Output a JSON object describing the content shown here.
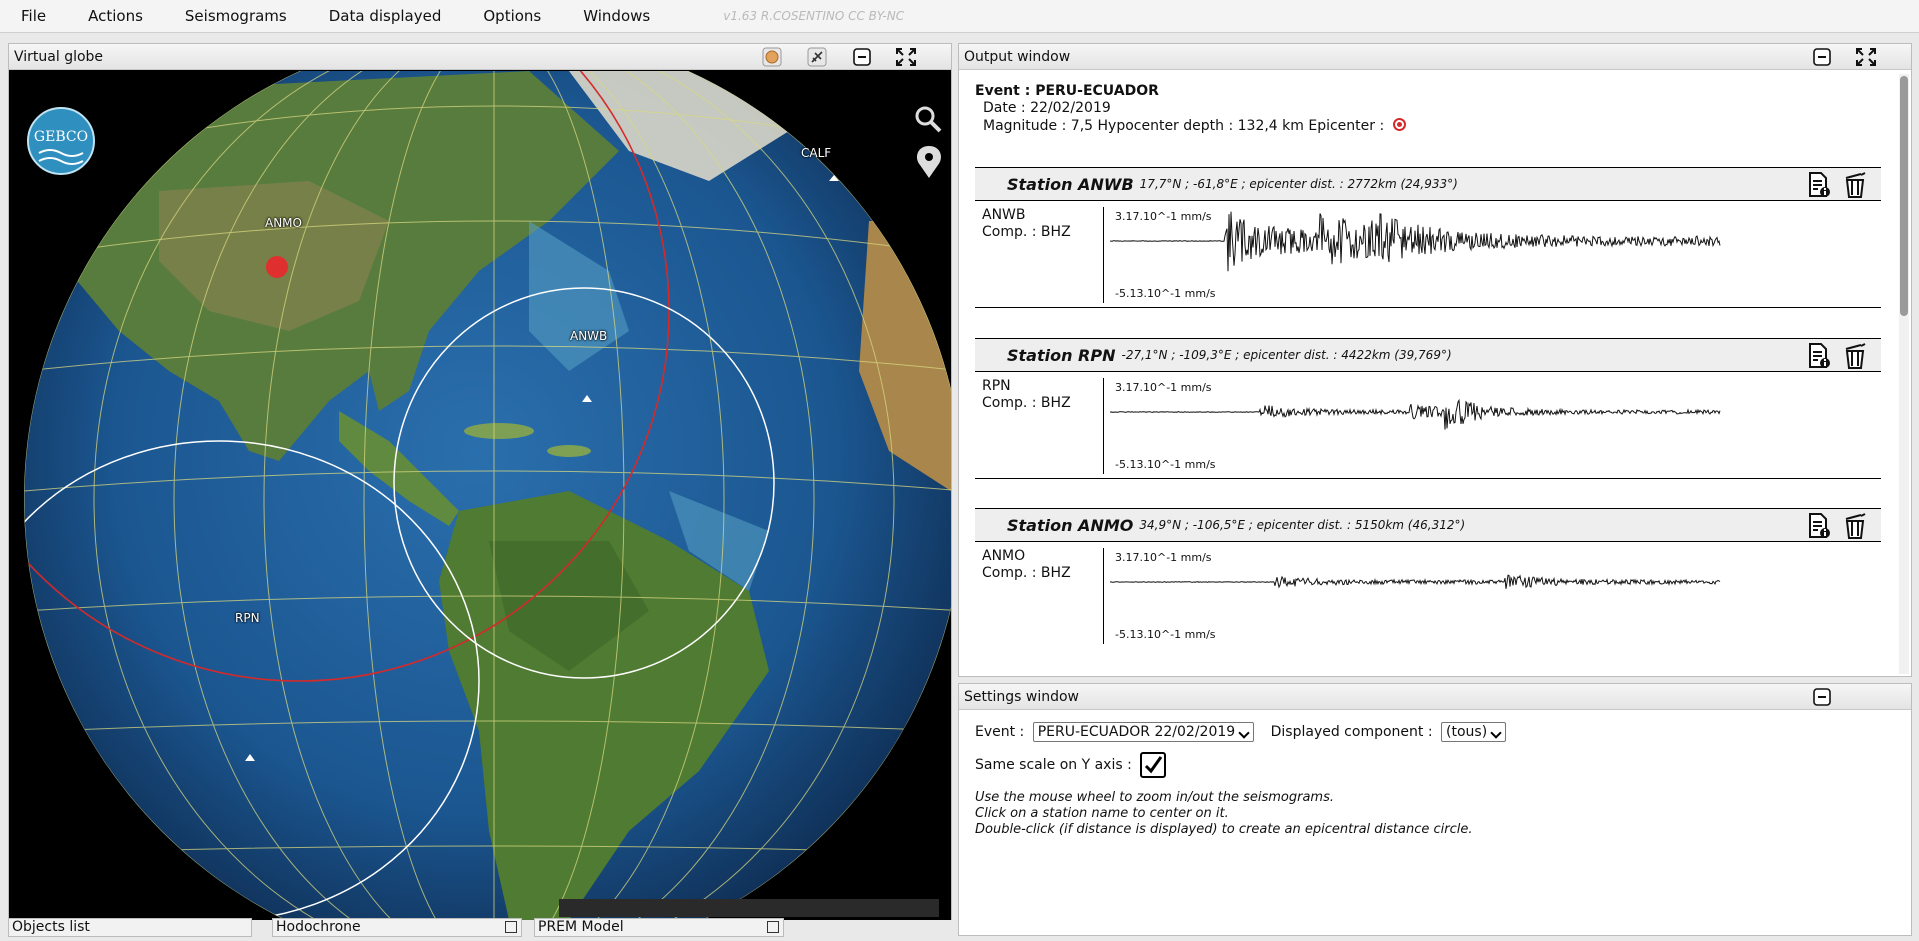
{
  "menu": {
    "items": [
      "File",
      "Actions",
      "Seismograms",
      "Data displayed",
      "Options",
      "Windows"
    ],
    "version": "v1.63 R.COSENTINO CC BY-NC"
  },
  "globe": {
    "title": "Virtual globe",
    "logo": "GEBCO",
    "stations": {
      "calf": "CALF",
      "anmo": "ANMO",
      "anwb": "ANWB",
      "rpn": "RPN"
    },
    "tabs": {
      "objects": "Objects list",
      "hodochrone": "Hodochrone",
      "prem": "PREM Model"
    }
  },
  "output": {
    "title": "Output window",
    "event_line": "Event : PERU-ECUADOR",
    "date_line": "Date : 22/02/2019",
    "magnitude_line": "Magnitude : 7,5  Hypocenter depth : 132,4 km  Epicenter :",
    "stations": [
      {
        "name": "Station ANWB",
        "info": "17,7°N ; -61,8°E ; epicenter dist. : 2772km (24,933°)",
        "code": "ANWB",
        "comp": "Comp. : BHZ",
        "max": "3.17.10^-1 mm/s",
        "min": "-5.13.10^-1 mm/s"
      },
      {
        "name": "Station RPN",
        "info": "-27,1°N ; -109,3°E ; epicenter dist. : 4422km (39,769°)",
        "code": "RPN",
        "comp": "Comp. : BHZ",
        "max": "3.17.10^-1 mm/s",
        "min": "-5.13.10^-1 mm/s"
      },
      {
        "name": "Station ANMO",
        "info": "34,9°N ; -106,5°E ; epicenter dist. : 5150km (46,312°)",
        "code": "ANMO",
        "comp": "Comp. : BHZ",
        "max": "3.17.10^-1 mm/s",
        "min": "-5.13.10^-1 mm/s"
      }
    ]
  },
  "settings": {
    "title": "Settings window",
    "event_label": "Event :",
    "event_value": "PERU-ECUADOR 22/02/2019",
    "component_label": "Displayed component :",
    "component_value": "(tous)",
    "same_scale_label": "Same scale on Y axis :",
    "same_scale_checked": true,
    "help_1": "Use the mouse wheel to zoom in/out the seismograms.",
    "help_2": "Click on a station name to center on it.",
    "help_3": "Double-click (if distance is displayed) to create an epicentral distance circle."
  },
  "colors": {
    "ocean": "#1e5b92",
    "land": "#4e7a3a",
    "epicenter_circle": "#d42a2a",
    "grid": "#d8d880"
  }
}
